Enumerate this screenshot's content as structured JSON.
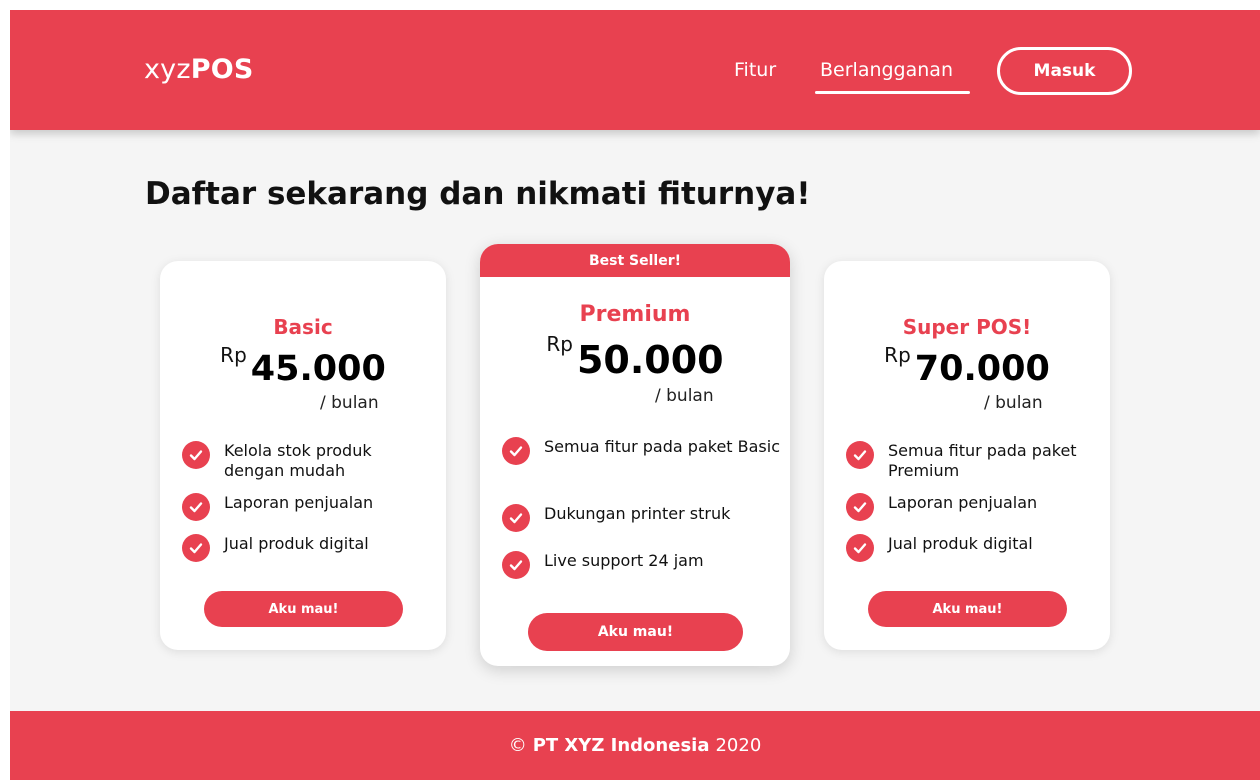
{
  "header": {
    "logo_prefix": "xyz",
    "logo_suffix": "POS",
    "nav": [
      {
        "label": "Fitur"
      },
      {
        "label": "Berlangganan",
        "active": true
      }
    ],
    "login_label": "Masuk"
  },
  "main": {
    "title": "Daftar sekarang dan nikmati fiturnya!",
    "plans": [
      {
        "name": "Basic",
        "currency": "Rp",
        "price": "45.000",
        "period": "/ bulan",
        "features": [
          "Kelola stok produk dengan mudah",
          "Laporan penjualan",
          "Jual produk digital"
        ],
        "cta": "Aku mau!"
      },
      {
        "badge": "Best Seller!",
        "name": "Premium",
        "currency": "Rp",
        "price": "50.000",
        "period": "/ bulan",
        "features": [
          "Semua fitur pada paket Basic",
          "Dukungan printer struk",
          "Live support 24 jam"
        ],
        "cta": "Aku mau!"
      },
      {
        "name": "Super POS!",
        "currency": "Rp",
        "price": "70.000",
        "period": "/ bulan",
        "features": [
          "Semua fitur pada paket Premium",
          "Laporan penjualan",
          "Jual produk digital"
        ],
        "cta": "Aku mau!"
      }
    ]
  },
  "footer": {
    "copyright_symbol": "©",
    "company": "PT XYZ Indonesia",
    "year": "2020"
  },
  "colors": {
    "accent": "#e84150",
    "background": "#f5f5f5",
    "card": "#ffffff"
  },
  "icons": {
    "feature_check": "check-circle-icon"
  }
}
